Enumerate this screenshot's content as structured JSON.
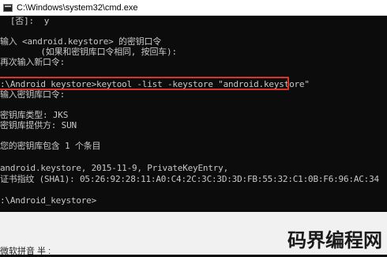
{
  "window": {
    "title": "C:\\Windows\\system32\\cmd.exe"
  },
  "console": {
    "lines": [
      "  [否]:  y",
      "",
      "输入 <android.keystore> 的密钥口令",
      "        (如果和密钥库口令相同, 按回车):",
      "再次输入新口令:",
      "",
      ":\\Android_keystore>keytool -list -keystore \"android.keystore\"",
      "输入密钥库口令:",
      "",
      "密钥库类型: JKS",
      "密钥库提供方: SUN",
      "",
      "您的密钥库包含 1 个条目",
      "",
      "android.keystore, 2015-11-9, PrivateKeyEntry,",
      "证书指纹 (SHA1): 05:26:92:28:11:A0:C4:2C:3C:3D:3D:FB:55:32:C1:0B:F6:96:AC:34",
      "",
      ":\\Android_keystore>"
    ]
  },
  "ime": {
    "status": "微软拼音 半 :"
  },
  "watermark": {
    "text": "码界编程网"
  },
  "colors": {
    "console_bg": "#0c0c0c",
    "console_text": "#c8c8c8",
    "highlight_border": "#d9332b"
  }
}
